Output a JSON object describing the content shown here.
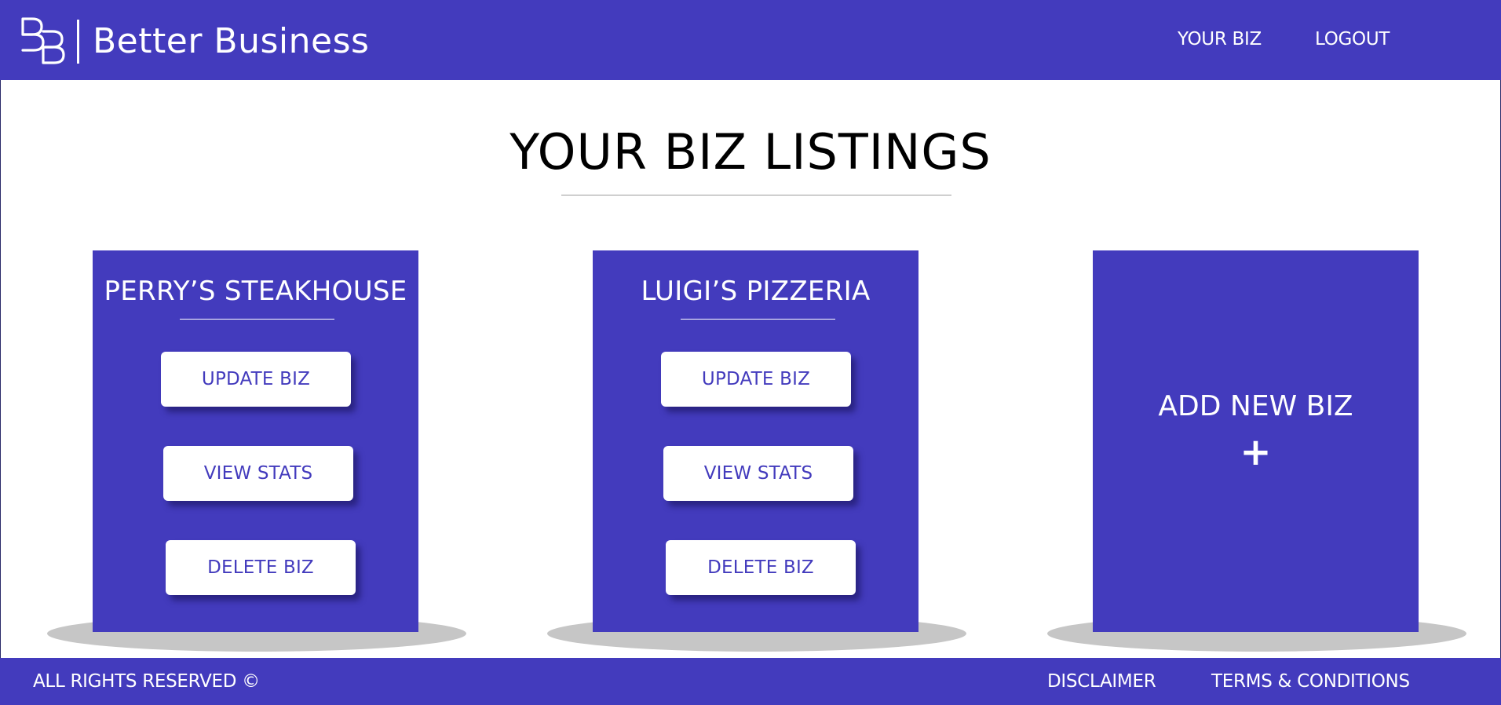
{
  "header": {
    "brand_name": "Better Business",
    "logo_icon": "bb-monogram-icon",
    "nav": {
      "your_biz": "YOUR BIZ",
      "logout": "LOGOUT"
    }
  },
  "main": {
    "title": "YOUR BIZ LISTINGS",
    "listings": [
      {
        "name": "PERRY’S STEAKHOUSE",
        "update_label": "UPDATE BIZ",
        "stats_label": "VIEW STATS",
        "delete_label": "DELETE BIZ"
      },
      {
        "name": "LUIGI’S PIZZERIA",
        "update_label": "UPDATE BIZ",
        "stats_label": "VIEW STATS",
        "delete_label": "DELETE BIZ"
      }
    ],
    "add_card": {
      "label": "ADD NEW BIZ",
      "icon": "plus-icon",
      "symbol": "+"
    }
  },
  "footer": {
    "copyright": "ALL RIGHTS RESERVED ©",
    "disclaimer": "DISCLAIMER",
    "terms": "TERMS & CONDITIONS"
  },
  "colors": {
    "brand": "#433bbd",
    "text_on_brand": "#ffffff",
    "shadow": "#c6c6c6"
  }
}
